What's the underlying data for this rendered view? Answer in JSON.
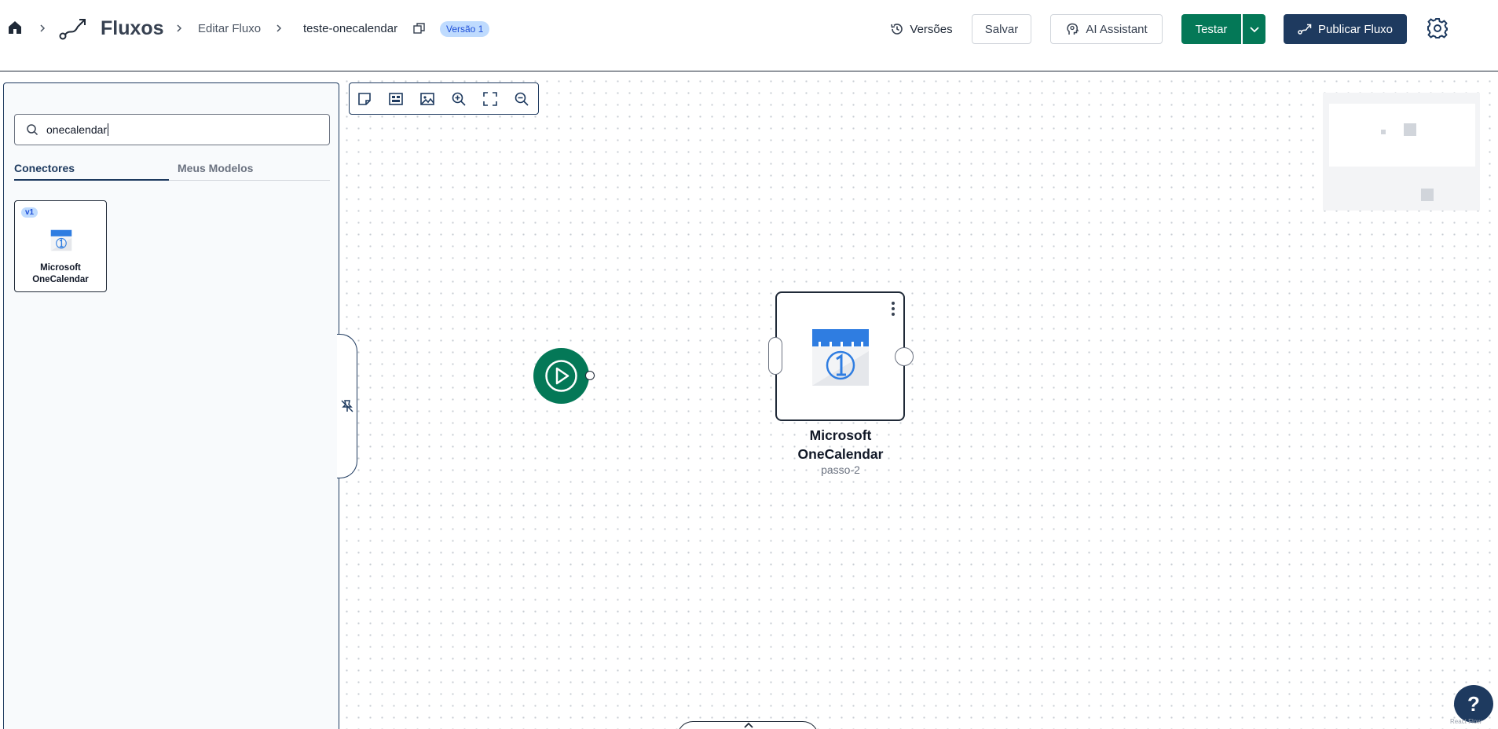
{
  "header": {
    "section_title": "Fluxos",
    "breadcrumb_edit": "Editar Fluxo",
    "flow_name": "teste-onecalendar",
    "version_badge": "Versão 1",
    "versions_label": "Versões",
    "save_label": "Salvar",
    "ai_label": "AI Assistant",
    "test_label": "Testar",
    "publish_label": "Publicar Fluxo"
  },
  "sidebar": {
    "search": {
      "value": "onecalendar",
      "placeholder": ""
    },
    "tabs": [
      {
        "label": "Conectores",
        "active": true
      },
      {
        "label": "Meus Modelos",
        "active": false
      }
    ],
    "connectors": [
      {
        "badge": "v1",
        "line1": "Microsoft",
        "line2": "OneCalendar"
      }
    ]
  },
  "canvas": {
    "step_node": {
      "title_line1": "Microsoft",
      "title_line2": "OneCalendar",
      "subtitle": "passo-2"
    },
    "help_label": "?",
    "attribution": "React Flow"
  },
  "colors": {
    "accent_green": "#047857",
    "navy": "#1e3a5f",
    "badge_bg": "#bfdbfe",
    "badge_text": "#1d4ed8"
  },
  "icons": {
    "home": "home-icon",
    "flow": "flow-icon",
    "copy": "copy-icon",
    "history": "history-icon",
    "ai": "ai-head-icon",
    "settings": "gear-icon",
    "search": "search-icon",
    "pin": "pin-off-icon"
  }
}
